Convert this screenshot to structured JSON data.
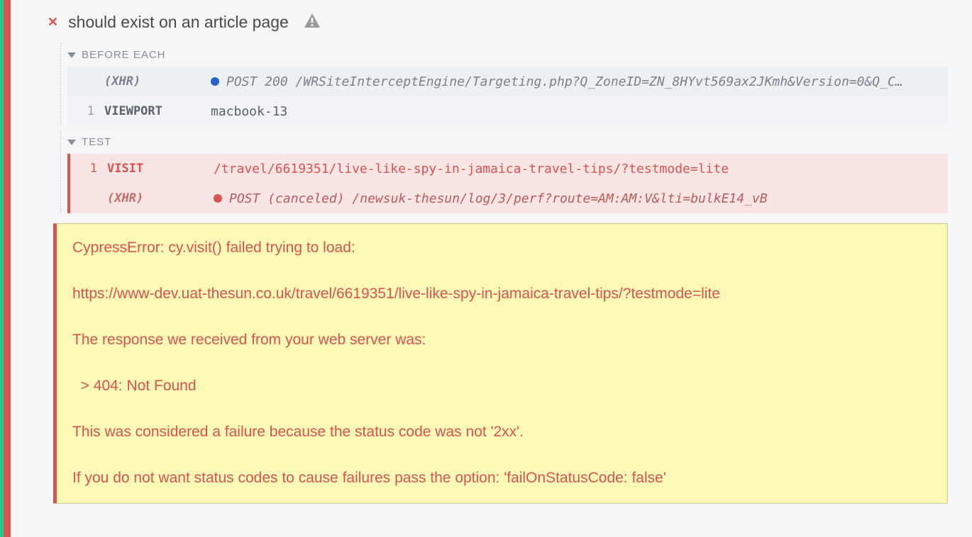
{
  "test": {
    "title": "should exist on an article page"
  },
  "sections": {
    "before_each": {
      "label": "BEFORE EACH",
      "rows": [
        {
          "num": "",
          "name": "(XHR)",
          "body": "POST 200 /WRSiteInterceptEngine/Targeting.php?Q_ZoneID=ZN_8HYvt569ax2JKmh&Version=0&Q_C…"
        },
        {
          "num": "1",
          "name": "VIEWPORT",
          "body": "macbook-13"
        }
      ]
    },
    "test": {
      "label": "TEST",
      "rows": [
        {
          "num": "1",
          "name": "VISIT",
          "body": "/travel/6619351/live-like-spy-in-jamaica-travel-tips/?testmode=lite"
        },
        {
          "num": "",
          "name": "(XHR)",
          "body": "POST (canceled) /newsuk-thesun/log/3/perf?route=AM:AM:V&lti=bulkE14_vB"
        }
      ]
    }
  },
  "error": "CypressError: cy.visit() failed trying to load:\n\nhttps://www-dev.uat-thesun.co.uk/travel/6619351/live-like-spy-in-jamaica-travel-tips/?testmode=lite\n\nThe response we received from your web server was:\n\n  > 404: Not Found\n\nThis was considered a failure because the status code was not '2xx'.\n\nIf you do not want status codes to cause failures pass the option: 'failOnStatusCode: false'"
}
